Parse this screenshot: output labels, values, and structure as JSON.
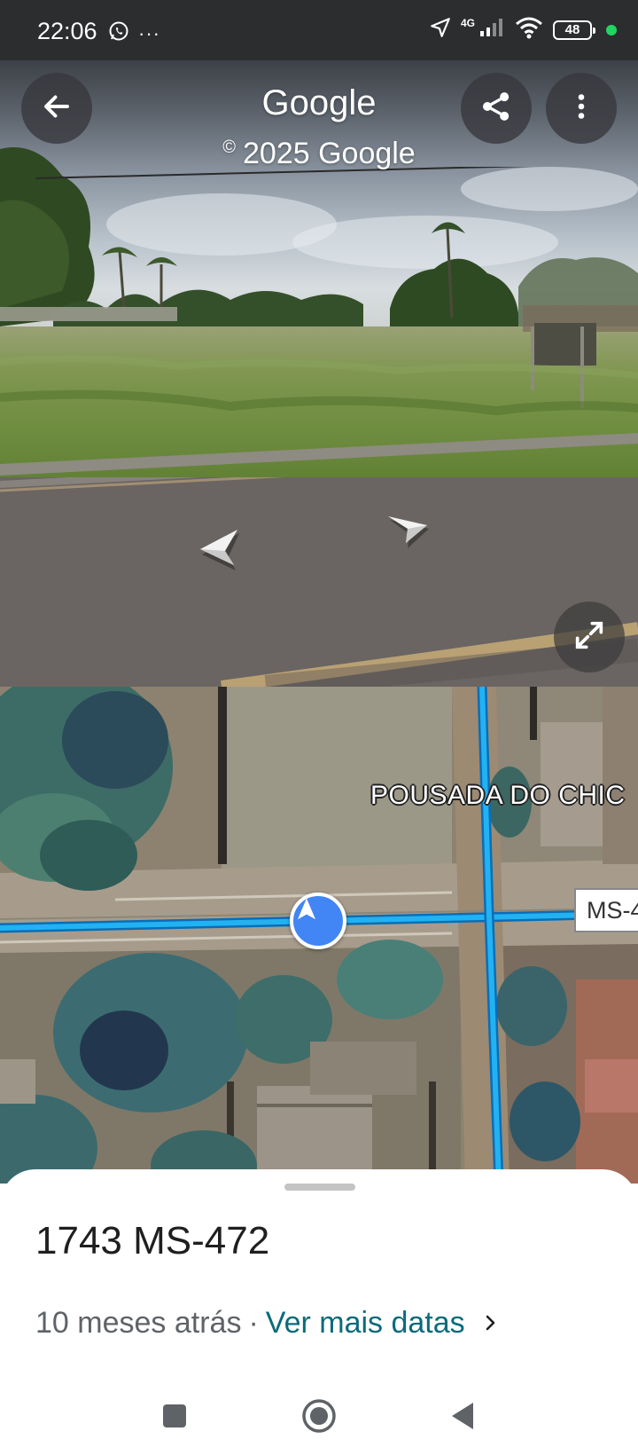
{
  "status_bar": {
    "time": "22:06",
    "more_indicator": "···",
    "network": "4G",
    "battery": "48"
  },
  "street_view": {
    "title": "Google",
    "copyright": "2025 Google",
    "copyright_symbol": "©",
    "icons": {
      "back": "arrow-left-icon",
      "share": "share-icon",
      "more": "more-vert-icon",
      "expand": "expand-icon",
      "nav_left": "chevron-left-icon",
      "nav_right": "chevron-right-icon"
    }
  },
  "map": {
    "poi_label": "POUSADA DO CHIC",
    "road_shield": "MS-4",
    "route_color": "#1aa7ec",
    "marker_color": "#4285f4"
  },
  "sheet": {
    "address": "1743 MS-472",
    "age": "10 meses atrás",
    "separator": "·",
    "more_dates_link": "Ver mais datas",
    "chevron": "›"
  },
  "nav_bar": {
    "icons": [
      "recents-icon",
      "home-icon",
      "back-icon"
    ]
  }
}
